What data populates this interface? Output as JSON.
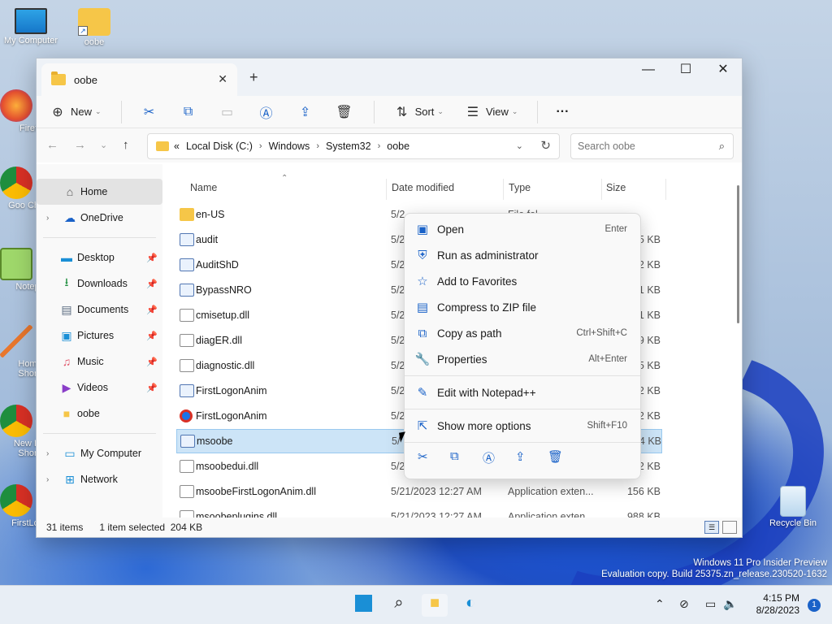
{
  "desktop": {
    "icons": [
      {
        "label": "My Computer",
        "icon": "monitor-icon"
      },
      {
        "label": "oobe",
        "icon": "folder-icon"
      },
      {
        "label": "Firef",
        "icon": "firefox-icon"
      },
      {
        "label": "Goo Chro",
        "icon": "chrome-icon"
      },
      {
        "label": "Notep",
        "icon": "notepad-icon"
      },
      {
        "label": "Hom Shor",
        "icon": "shortcut-icon"
      },
      {
        "label": "New In Shor",
        "icon": "chrome-icon"
      },
      {
        "label": "FirstLog",
        "icon": "chrome-icon"
      },
      {
        "label": "Recycle Bin",
        "icon": "recycle-bin-icon"
      }
    ],
    "watermark_line1": "Windows 11 Pro Insider Preview",
    "watermark_line2": "Evaluation copy. Build 25375.zn_release.230520-1632"
  },
  "window": {
    "tab_title": "oobe",
    "new_tab": "+",
    "controls": {
      "minimize": "—",
      "maximize": "☐",
      "close": "✕"
    },
    "toolbar": {
      "new_label": "New",
      "sort_label": "Sort",
      "view_label": "View",
      "more_label": "···"
    },
    "address": {
      "prefix": "«",
      "crumbs": [
        "Local Disk (C:)",
        "Windows",
        "System32",
        "oobe"
      ],
      "search_placeholder": "Search oobe"
    },
    "sidebar": {
      "home": "Home",
      "onedrive": "OneDrive",
      "quick": [
        "Desktop",
        "Downloads",
        "Documents",
        "Pictures",
        "Music",
        "Videos",
        "oobe"
      ],
      "my_computer": "My Computer",
      "network": "Network"
    },
    "columns": {
      "name": "Name",
      "date": "Date modified",
      "type": "Type",
      "size": "Size"
    },
    "files": [
      {
        "name": "en-US",
        "date": "5/2",
        "type": "File fol",
        "size": "",
        "kind": "folder"
      },
      {
        "name": "audit",
        "date": "5/2",
        "type": "",
        "size": "5 KB",
        "kind": "app"
      },
      {
        "name": "AuditShD",
        "date": "5/2",
        "type": "",
        "size": "2 KB",
        "kind": "app"
      },
      {
        "name": "BypassNRO",
        "date": "5/2",
        "type": "",
        "size": "1 KB",
        "kind": "app"
      },
      {
        "name": "cmisetup.dll",
        "date": "5/2",
        "type": "",
        "size": "1 KB",
        "kind": "dll"
      },
      {
        "name": "diagER.dll",
        "date": "5/2",
        "type": "",
        "size": "9 KB",
        "kind": "dll"
      },
      {
        "name": "diagnostic.dll",
        "date": "5/2",
        "type": "",
        "size": "5 KB",
        "kind": "dll"
      },
      {
        "name": "FirstLogonAnim",
        "date": "5/2",
        "type": "",
        "size": "2 KB",
        "kind": "app"
      },
      {
        "name": "FirstLogonAnim",
        "date": "5/2",
        "type": "",
        "size": "2 KB",
        "kind": "chrome"
      },
      {
        "name": "msoobe",
        "date": "5/",
        "type": "",
        "size": "4 KB",
        "kind": "app"
      },
      {
        "name": "msoobedui.dll",
        "date": "5/2",
        "type": "",
        "size": "2 KB",
        "kind": "dll"
      },
      {
        "name": "msoobeFirstLogonAnim.dll",
        "date": "5/21/2023 12:27 AM",
        "type": "Application exten...",
        "size": "156 KB",
        "kind": "dll"
      },
      {
        "name": "msoobeplugins.dll",
        "date": "5/21/2023 12:27 AM",
        "type": "Application exten...",
        "size": "988 KB",
        "kind": "dll"
      }
    ],
    "status": {
      "count": "31 items",
      "selection": "1 item selected  204 KB"
    }
  },
  "context_menu": {
    "items": [
      {
        "label": "Open",
        "shortcut": "Enter",
        "icon": "app-window-icon"
      },
      {
        "label": "Run as administrator",
        "shortcut": "",
        "icon": "shield-icon"
      },
      {
        "label": "Add to Favorites",
        "shortcut": "",
        "icon": "star-icon"
      },
      {
        "label": "Compress to ZIP file",
        "shortcut": "",
        "icon": "zip-icon"
      },
      {
        "label": "Copy as path",
        "shortcut": "Ctrl+Shift+C",
        "icon": "copy-path-icon"
      },
      {
        "label": "Properties",
        "shortcut": "Alt+Enter",
        "icon": "wrench-icon"
      },
      {
        "label": "Edit with Notepad++",
        "shortcut": "",
        "icon": "notepad-icon"
      },
      {
        "label": "Show more options",
        "shortcut": "Shift+F10",
        "icon": "expand-icon"
      }
    ]
  },
  "taskbar": {
    "time": "4:15 PM",
    "date": "8/28/2023",
    "notification_count": "1"
  }
}
